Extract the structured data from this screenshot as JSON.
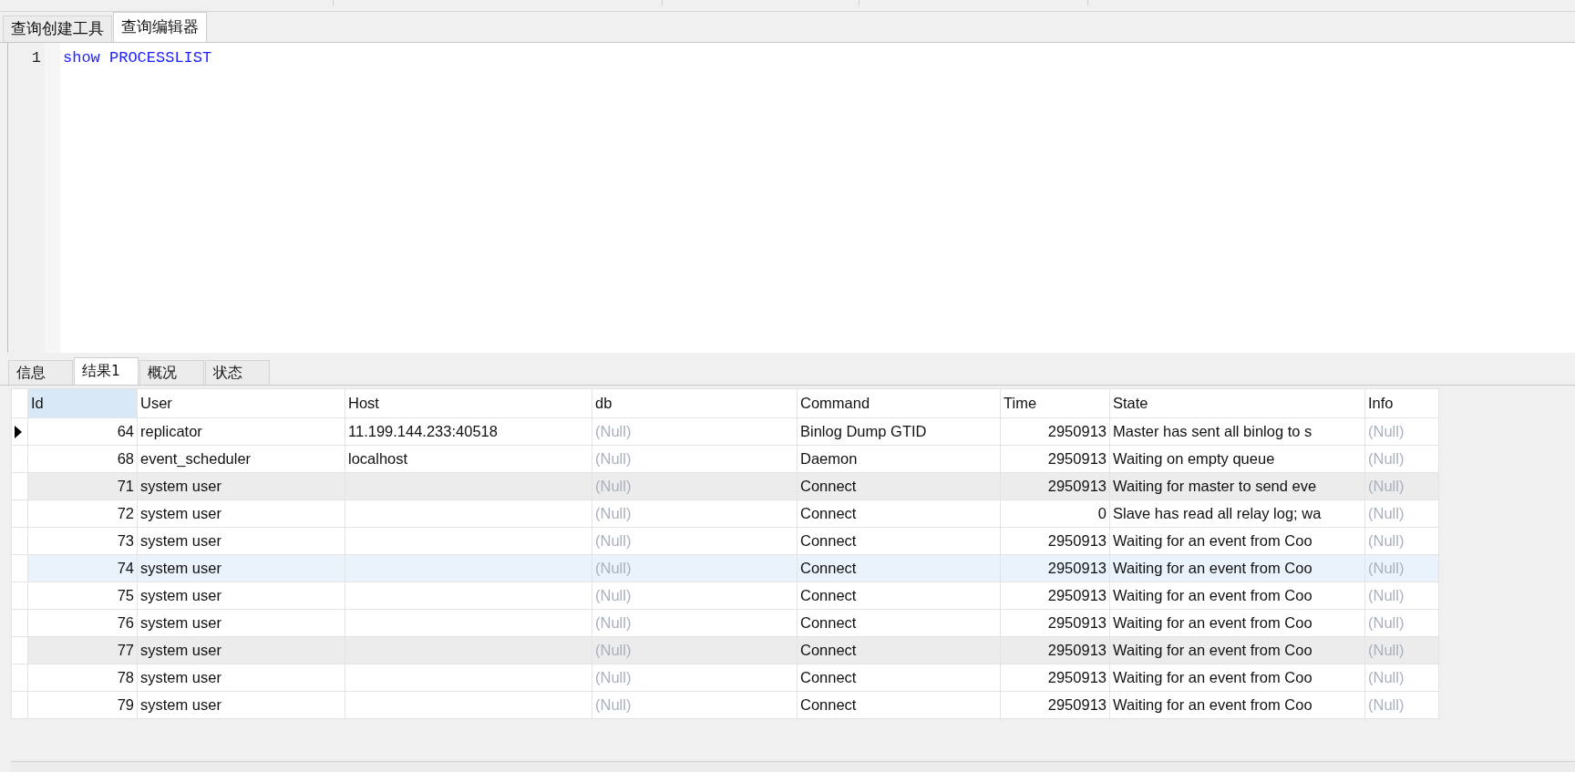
{
  "editor_tabs": [
    {
      "label": "查询创建工具",
      "selected": false
    },
    {
      "label": "查询编辑器",
      "selected": true
    }
  ],
  "editor": {
    "lines": [
      {
        "number": "1",
        "tokens": [
          "show",
          "PROCESSLIST"
        ]
      }
    ]
  },
  "result_tabs": [
    {
      "label": "信息",
      "selected": false
    },
    {
      "label": "结果1",
      "selected": true
    },
    {
      "label": "概况",
      "selected": false
    },
    {
      "label": "状态",
      "selected": false
    }
  ],
  "table": {
    "columns": [
      {
        "label": "Id",
        "kind": "numeric",
        "selected": true
      },
      {
        "label": "User",
        "kind": "text",
        "selected": false
      },
      {
        "label": "Host",
        "kind": "text",
        "selected": false
      },
      {
        "label": "db",
        "kind": "text",
        "selected": false
      },
      {
        "label": "Command",
        "kind": "text",
        "selected": false
      },
      {
        "label": "Time",
        "kind": "numeric",
        "selected": false
      },
      {
        "label": "State",
        "kind": "text",
        "selected": false
      },
      {
        "label": "Info",
        "kind": "text",
        "selected": false
      }
    ],
    "rows": [
      {
        "current": true,
        "selected": false,
        "hovered": false,
        "cells": [
          {
            "text": "64",
            "null": false
          },
          {
            "text": "replicator",
            "null": false
          },
          {
            "text": "11.199.144.233:40518",
            "null": false
          },
          {
            "text": "(Null)",
            "null": true
          },
          {
            "text": "Binlog Dump GTID",
            "null": false
          },
          {
            "text": "2950913",
            "null": false
          },
          {
            "text": "Master has sent all binlog to s",
            "null": false
          },
          {
            "text": "(Null)",
            "null": true
          }
        ]
      },
      {
        "current": false,
        "selected": false,
        "hovered": false,
        "cells": [
          {
            "text": "68",
            "null": false
          },
          {
            "text": "event_scheduler",
            "null": false
          },
          {
            "text": "localhost",
            "null": false
          },
          {
            "text": "(Null)",
            "null": true
          },
          {
            "text": "Daemon",
            "null": false
          },
          {
            "text": "2950913",
            "null": false
          },
          {
            "text": "Waiting on empty queue",
            "null": false
          },
          {
            "text": "(Null)",
            "null": true
          }
        ]
      },
      {
        "current": false,
        "selected": true,
        "hovered": false,
        "cells": [
          {
            "text": "71",
            "null": false
          },
          {
            "text": "system user",
            "null": false
          },
          {},
          {
            "text": "(Null)",
            "null": true
          },
          {
            "text": "Connect",
            "null": false
          },
          {
            "text": "2950913",
            "null": false
          },
          {
            "text": "Waiting for master to send eve",
            "null": false
          },
          {
            "text": "(Null)",
            "null": true
          }
        ]
      },
      {
        "current": false,
        "selected": false,
        "hovered": false,
        "cells": [
          {
            "text": "72",
            "null": false
          },
          {
            "text": "system user",
            "null": false
          },
          {},
          {
            "text": "(Null)",
            "null": true
          },
          {
            "text": "Connect",
            "null": false
          },
          {
            "text": "0",
            "null": false
          },
          {
            "text": "Slave has read all relay log; wa",
            "null": false
          },
          {
            "text": "(Null)",
            "null": true
          }
        ]
      },
      {
        "current": false,
        "selected": false,
        "hovered": false,
        "cells": [
          {
            "text": "73",
            "null": false
          },
          {
            "text": "system user",
            "null": false
          },
          {},
          {
            "text": "(Null)",
            "null": true
          },
          {
            "text": "Connect",
            "null": false
          },
          {
            "text": "2950913",
            "null": false
          },
          {
            "text": "Waiting for an event from Coo",
            "null": false
          },
          {
            "text": "(Null)",
            "null": true
          }
        ]
      },
      {
        "current": false,
        "selected": false,
        "hovered": true,
        "cells": [
          {
            "text": "74",
            "null": false
          },
          {
            "text": "system user",
            "null": false
          },
          {},
          {
            "text": "(Null)",
            "null": true
          },
          {
            "text": "Connect",
            "null": false
          },
          {
            "text": "2950913",
            "null": false
          },
          {
            "text": "Waiting for an event from Coo",
            "null": false
          },
          {
            "text": "(Null)",
            "null": true
          }
        ]
      },
      {
        "current": false,
        "selected": false,
        "hovered": false,
        "cells": [
          {
            "text": "75",
            "null": false
          },
          {
            "text": "system user",
            "null": false
          },
          {},
          {
            "text": "(Null)",
            "null": true
          },
          {
            "text": "Connect",
            "null": false
          },
          {
            "text": "2950913",
            "null": false
          },
          {
            "text": "Waiting for an event from Coo",
            "null": false
          },
          {
            "text": "(Null)",
            "null": true
          }
        ]
      },
      {
        "current": false,
        "selected": false,
        "hovered": false,
        "cells": [
          {
            "text": "76",
            "null": false
          },
          {
            "text": "system user",
            "null": false
          },
          {},
          {
            "text": "(Null)",
            "null": true
          },
          {
            "text": "Connect",
            "null": false
          },
          {
            "text": "2950913",
            "null": false
          },
          {
            "text": "Waiting for an event from Coo",
            "null": false
          },
          {
            "text": "(Null)",
            "null": true
          }
        ]
      },
      {
        "current": false,
        "selected": true,
        "hovered": false,
        "cells": [
          {
            "text": "77",
            "null": false
          },
          {
            "text": "system user",
            "null": false
          },
          {},
          {
            "text": "(Null)",
            "null": true
          },
          {
            "text": "Connect",
            "null": false
          },
          {
            "text": "2950913",
            "null": false
          },
          {
            "text": "Waiting for an event from Coo",
            "null": false
          },
          {
            "text": "(Null)",
            "null": true
          }
        ]
      },
      {
        "current": false,
        "selected": false,
        "hovered": false,
        "cells": [
          {
            "text": "78",
            "null": false
          },
          {
            "text": "system user",
            "null": false
          },
          {},
          {
            "text": "(Null)",
            "null": true
          },
          {
            "text": "Connect",
            "null": false
          },
          {
            "text": "2950913",
            "null": false
          },
          {
            "text": "Waiting for an event from Coo",
            "null": false
          },
          {
            "text": "(Null)",
            "null": true
          }
        ]
      },
      {
        "current": false,
        "selected": false,
        "hovered": false,
        "cells": [
          {
            "text": "79",
            "null": false
          },
          {
            "text": "system user",
            "null": false
          },
          {},
          {
            "text": "(Null)",
            "null": true
          },
          {
            "text": "Connect",
            "null": false
          },
          {
            "text": "2950913",
            "null": false
          },
          {
            "text": "Waiting for an event from Coo",
            "null": false
          },
          {
            "text": "(Null)",
            "null": true
          }
        ]
      }
    ]
  }
}
